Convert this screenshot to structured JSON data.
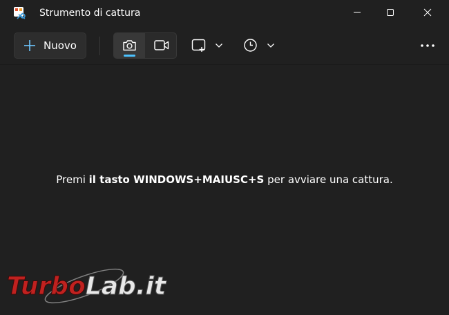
{
  "window": {
    "title": "Strumento di cattura",
    "app_icon": "snipping-tool-icon",
    "controls": [
      "minimize-icon",
      "maximize-icon",
      "close-icon"
    ]
  },
  "toolbar": {
    "new_label": "Nuovo",
    "modes": [
      {
        "name": "screenshot-mode",
        "icon": "camera-icon",
        "selected": true
      },
      {
        "name": "video-mode",
        "icon": "video-camera-icon",
        "selected": false
      }
    ],
    "shape_icon": "rectangle-snip-icon",
    "timer_icon": "clock-icon",
    "more_icon": "more-dots-icon"
  },
  "content": {
    "hint_prefix": "Premi ",
    "hint_bold": "il tasto WINDOWS+MAIUSC+S",
    "hint_suffix": " per avviare una cattura."
  },
  "watermark": {
    "text_1": "Turbo",
    "text_2": "Lab.it"
  },
  "colors": {
    "background": "#202020",
    "accent": "#4cc2ff",
    "watermark_red": "#c0211f"
  }
}
